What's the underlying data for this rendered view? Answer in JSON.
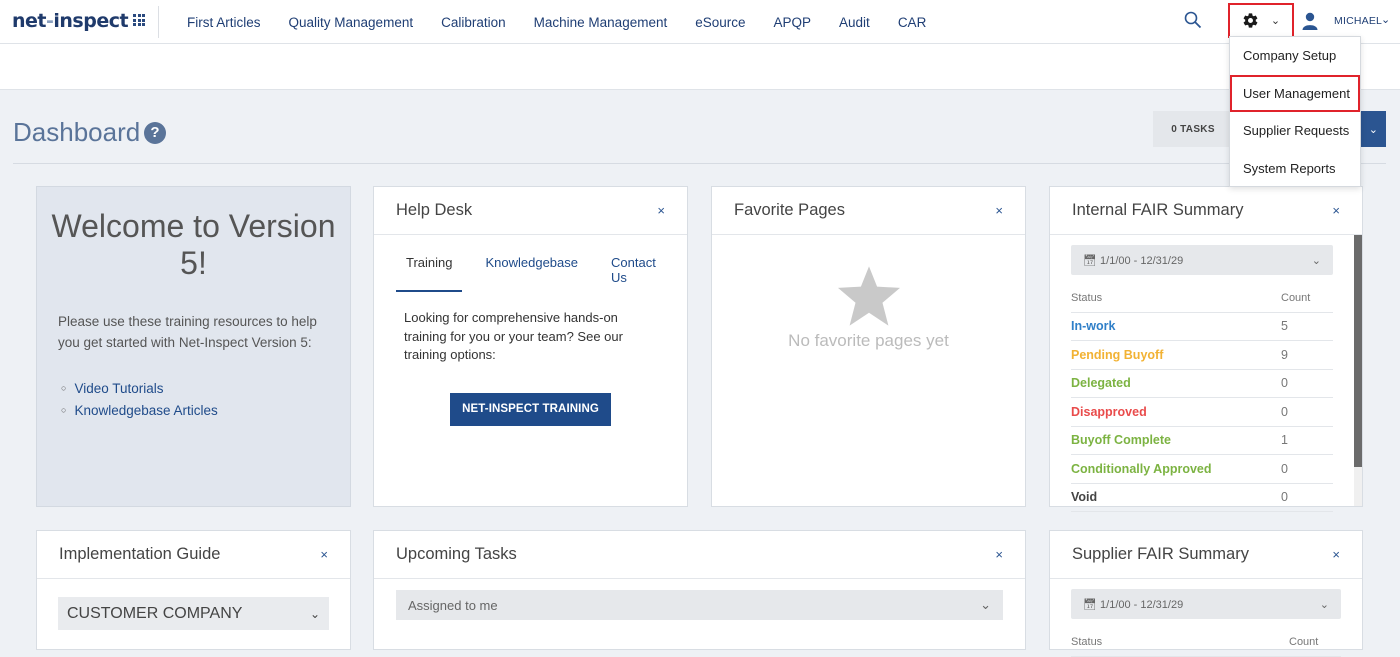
{
  "header": {
    "logo": "net-inspect",
    "nav": [
      "First Articles",
      "Quality Management",
      "Calibration",
      "Machine Management",
      "eSource",
      "APQP",
      "Audit",
      "CAR"
    ],
    "user_name": "MICHAEL",
    "icons": [
      "apps-grid-icon",
      "search-icon",
      "gear-icon",
      "user-icon"
    ]
  },
  "settings_menu": {
    "items": [
      "Company Setup",
      "User Management",
      "Supplier Requests",
      "System Reports"
    ],
    "highlighted": "User Management"
  },
  "page": {
    "title": "Dashboard",
    "help_glyph": "?",
    "tasks_label": "0 TASKS"
  },
  "welcome": {
    "heading": "Welcome to Version 5!",
    "body": "Please use these training resources to help you get started with Net-Inspect Version 5:",
    "links": [
      "Video Tutorials",
      "Knowledgebase Articles"
    ]
  },
  "help_desk": {
    "title": "Help Desk",
    "tabs": [
      "Training",
      "Knowledgebase",
      "Contact Us"
    ],
    "active_tab": "Training",
    "text": "Looking for comprehensive hands-on training for you or your team? See our training options:",
    "button": "NET-INSPECT TRAINING"
  },
  "favorite_pages": {
    "title": "Favorite Pages",
    "empty": "No favorite pages yet"
  },
  "internal_fair": {
    "title": "Internal FAIR Summary",
    "date_range": "1/1/00 - 12/31/29",
    "col_status": "Status",
    "col_count": "Count",
    "rows": [
      {
        "status": "In-work",
        "count": "5",
        "color": "#2f7fc8"
      },
      {
        "status": "Pending Buyoff",
        "count": "9",
        "color": "#f2b233"
      },
      {
        "status": "Delegated",
        "count": "0",
        "color": "#7cb342"
      },
      {
        "status": "Disapproved",
        "count": "0",
        "color": "#e94b4b"
      },
      {
        "status": "Buyoff Complete",
        "count": "1",
        "color": "#7cb342"
      },
      {
        "status": "Conditionally Approved",
        "count": "0",
        "color": "#7cb342"
      },
      {
        "status": "Void",
        "count": "0",
        "color": "#444444"
      }
    ]
  },
  "implementation_guide": {
    "title": "Implementation Guide",
    "company": "CUSTOMER COMPANY"
  },
  "upcoming_tasks": {
    "title": "Upcoming Tasks",
    "filter": "Assigned to me"
  },
  "supplier_fair": {
    "title": "Supplier FAIR Summary",
    "date_range": "1/1/00 - 12/31/29",
    "col_status": "Status",
    "col_count": "Count"
  },
  "close_glyph": "×",
  "caret_glyph": "⌄"
}
